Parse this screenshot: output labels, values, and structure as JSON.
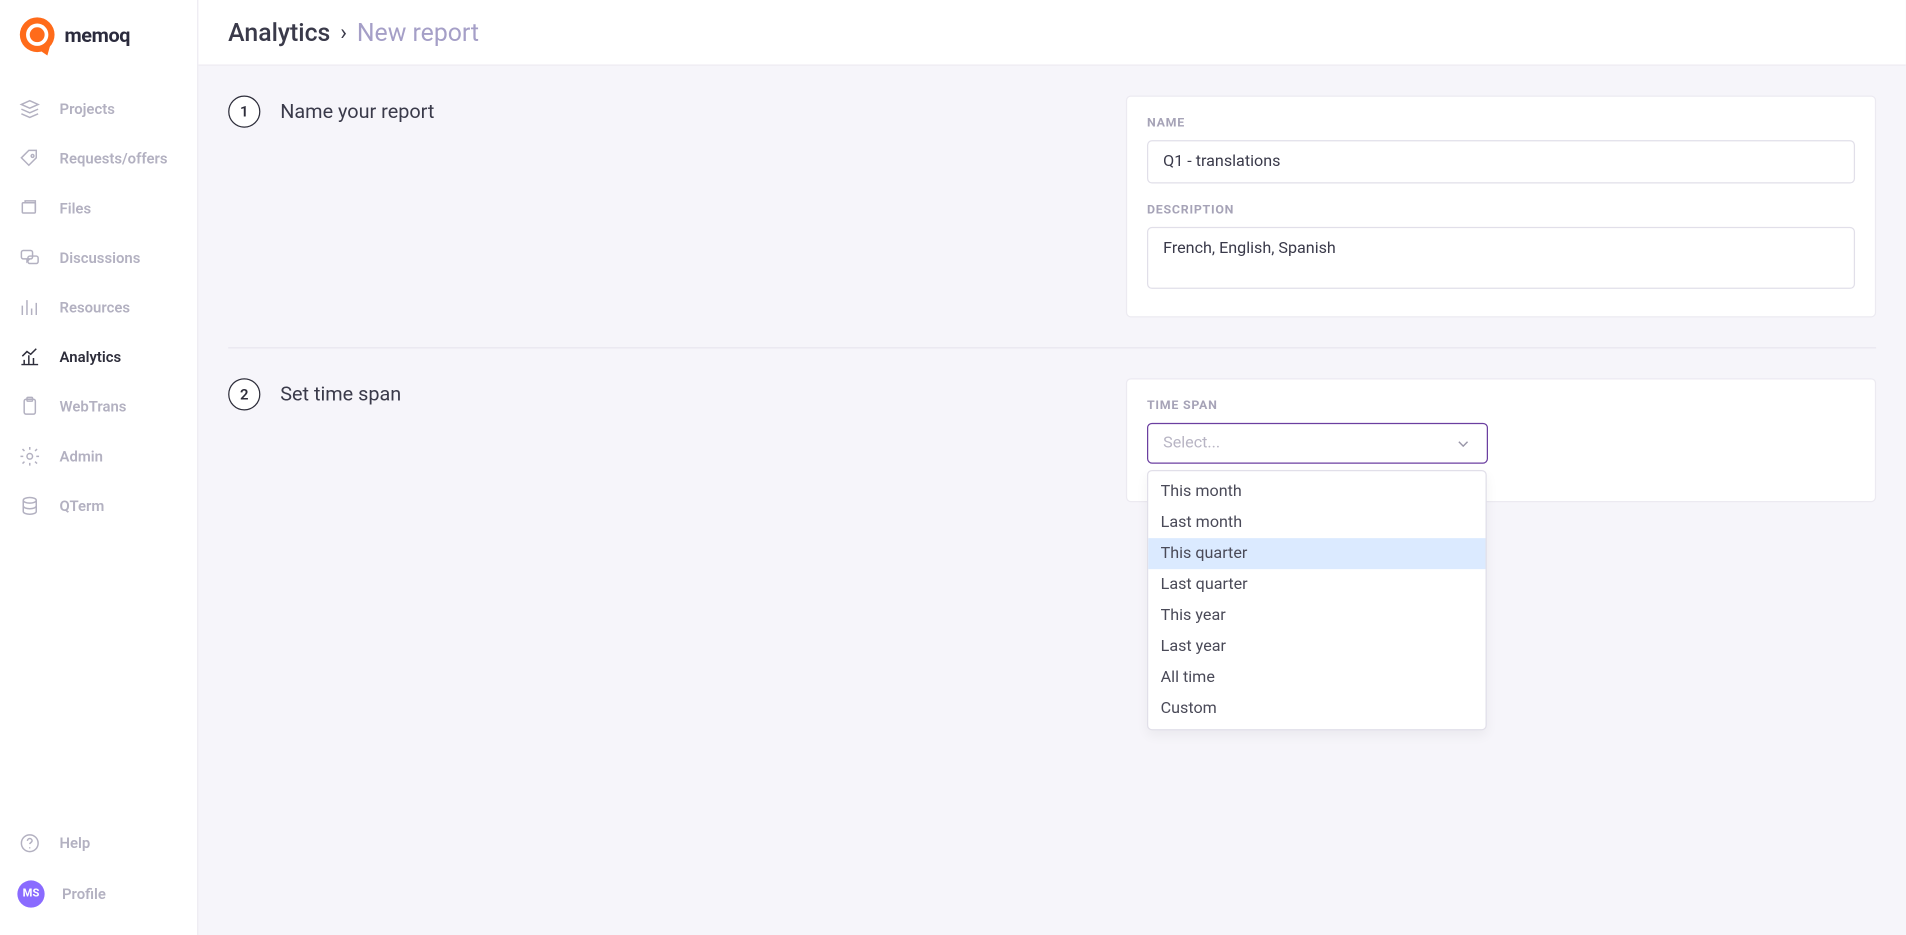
{
  "logo": {
    "text": "memoq"
  },
  "sidebar": {
    "items": [
      {
        "label": "Projects"
      },
      {
        "label": "Requests/offers"
      },
      {
        "label": "Files"
      },
      {
        "label": "Discussions"
      },
      {
        "label": "Resources"
      },
      {
        "label": "Analytics"
      },
      {
        "label": "WebTrans"
      },
      {
        "label": "Admin"
      },
      {
        "label": "QTerm"
      }
    ],
    "bottom": {
      "help": "Help",
      "profile": "Profile",
      "avatar_initials": "MS"
    }
  },
  "breadcrumb": {
    "root": "Analytics",
    "sep": "›",
    "current": "New report"
  },
  "step1": {
    "number": "1",
    "title": "Name your report",
    "name_label": "NAME",
    "name_value": "Q1 - translations",
    "desc_label": "DESCRIPTION",
    "desc_value": "French, English, Spanish"
  },
  "step2": {
    "number": "2",
    "title": "Set time span",
    "label": "TIME SPAN",
    "placeholder": "Select...",
    "options": [
      "This month",
      "Last month",
      "This quarter",
      "Last quarter",
      "This year",
      "Last year",
      "All time",
      "Custom"
    ],
    "highlighted_index": 2
  }
}
